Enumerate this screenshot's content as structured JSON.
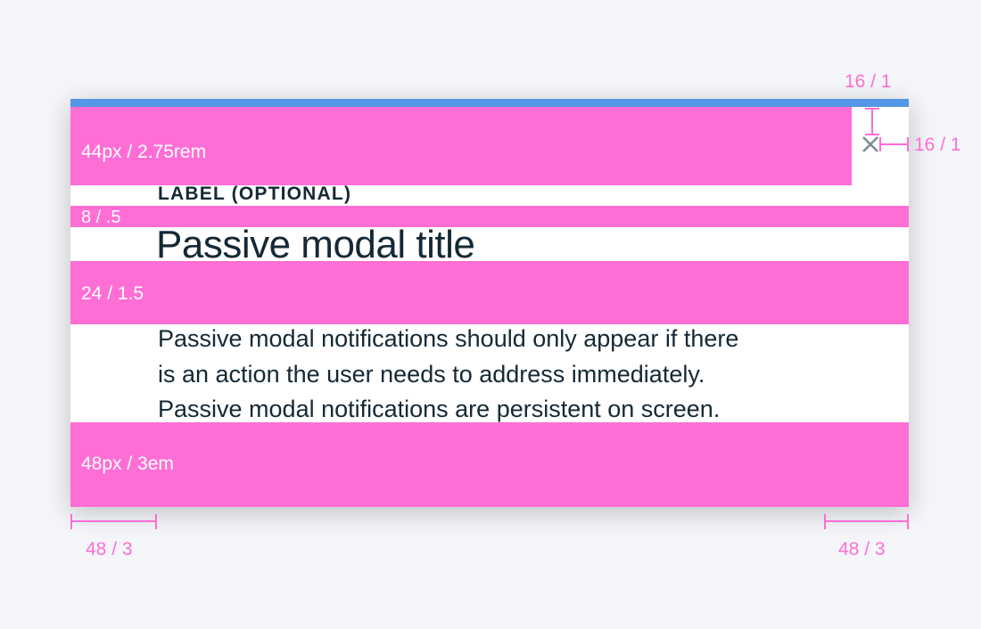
{
  "modal": {
    "label": "LABEL (OPTIONAL)",
    "title": "Passive modal title",
    "body_lines": [
      "Passive modal notifications should only appear if there",
      "is an action the user needs to address immediately.",
      "Passive modal notifications are persistent on screen."
    ],
    "close_icon": "close-icon"
  },
  "annotations": {
    "top_band": "44px / 2.75rem",
    "label_title_gap": "8 / .5",
    "title_body_gap": "24 / 1.5",
    "bottom_band": "48px / 3em",
    "close_top": "16 / 1",
    "close_right": "16 / 1",
    "left_padding": "48 / 3",
    "right_padding": "48 / 3"
  },
  "colors": {
    "accent": "#5596e6",
    "spacing_highlight": "#ff6ed5",
    "text": "#152935",
    "background": "#f4f6f9"
  }
}
